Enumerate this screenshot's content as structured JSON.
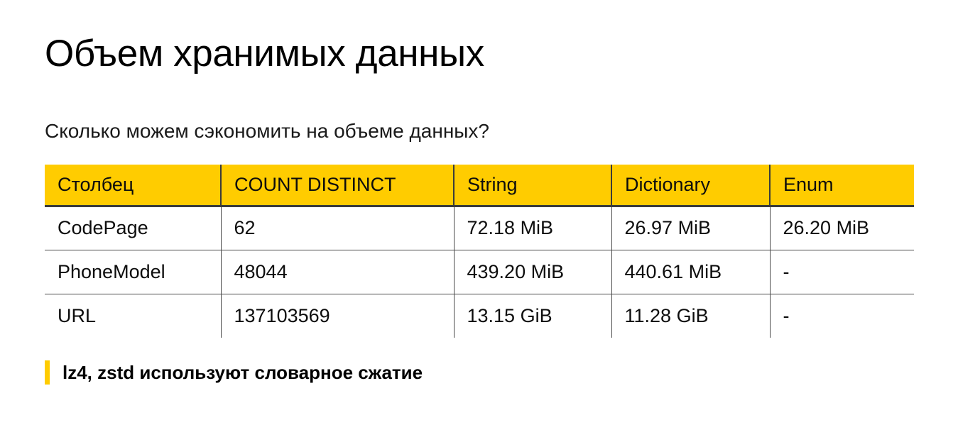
{
  "slide": {
    "title": "Объем хранимых данных",
    "subtitle": "Сколько можем сэкономить на объеме данных?",
    "accent_color": "#ffcc00",
    "text_color": "#000000",
    "background_color": "#ffffff"
  },
  "table": {
    "headers": [
      "Столбец",
      "COUNT DISTINCT",
      "String",
      "Dictionary",
      "Enum"
    ],
    "rows": [
      {
        "column": "CodePage",
        "count_distinct": "62",
        "string": "72.18 MiB",
        "dictionary": "26.97 MiB",
        "enum": "26.20 MiB"
      },
      {
        "column": "PhoneModel",
        "count_distinct": "48044",
        "string": "439.20 MiB",
        "dictionary": "440.61 MiB",
        "enum": "-"
      },
      {
        "column": "URL",
        "count_distinct": "137103569",
        "string": "13.15 GiB",
        "dictionary": "11.28 GiB",
        "enum": "-"
      }
    ]
  },
  "footnote": {
    "text": "lz4, zstd используют словарное сжатие"
  }
}
